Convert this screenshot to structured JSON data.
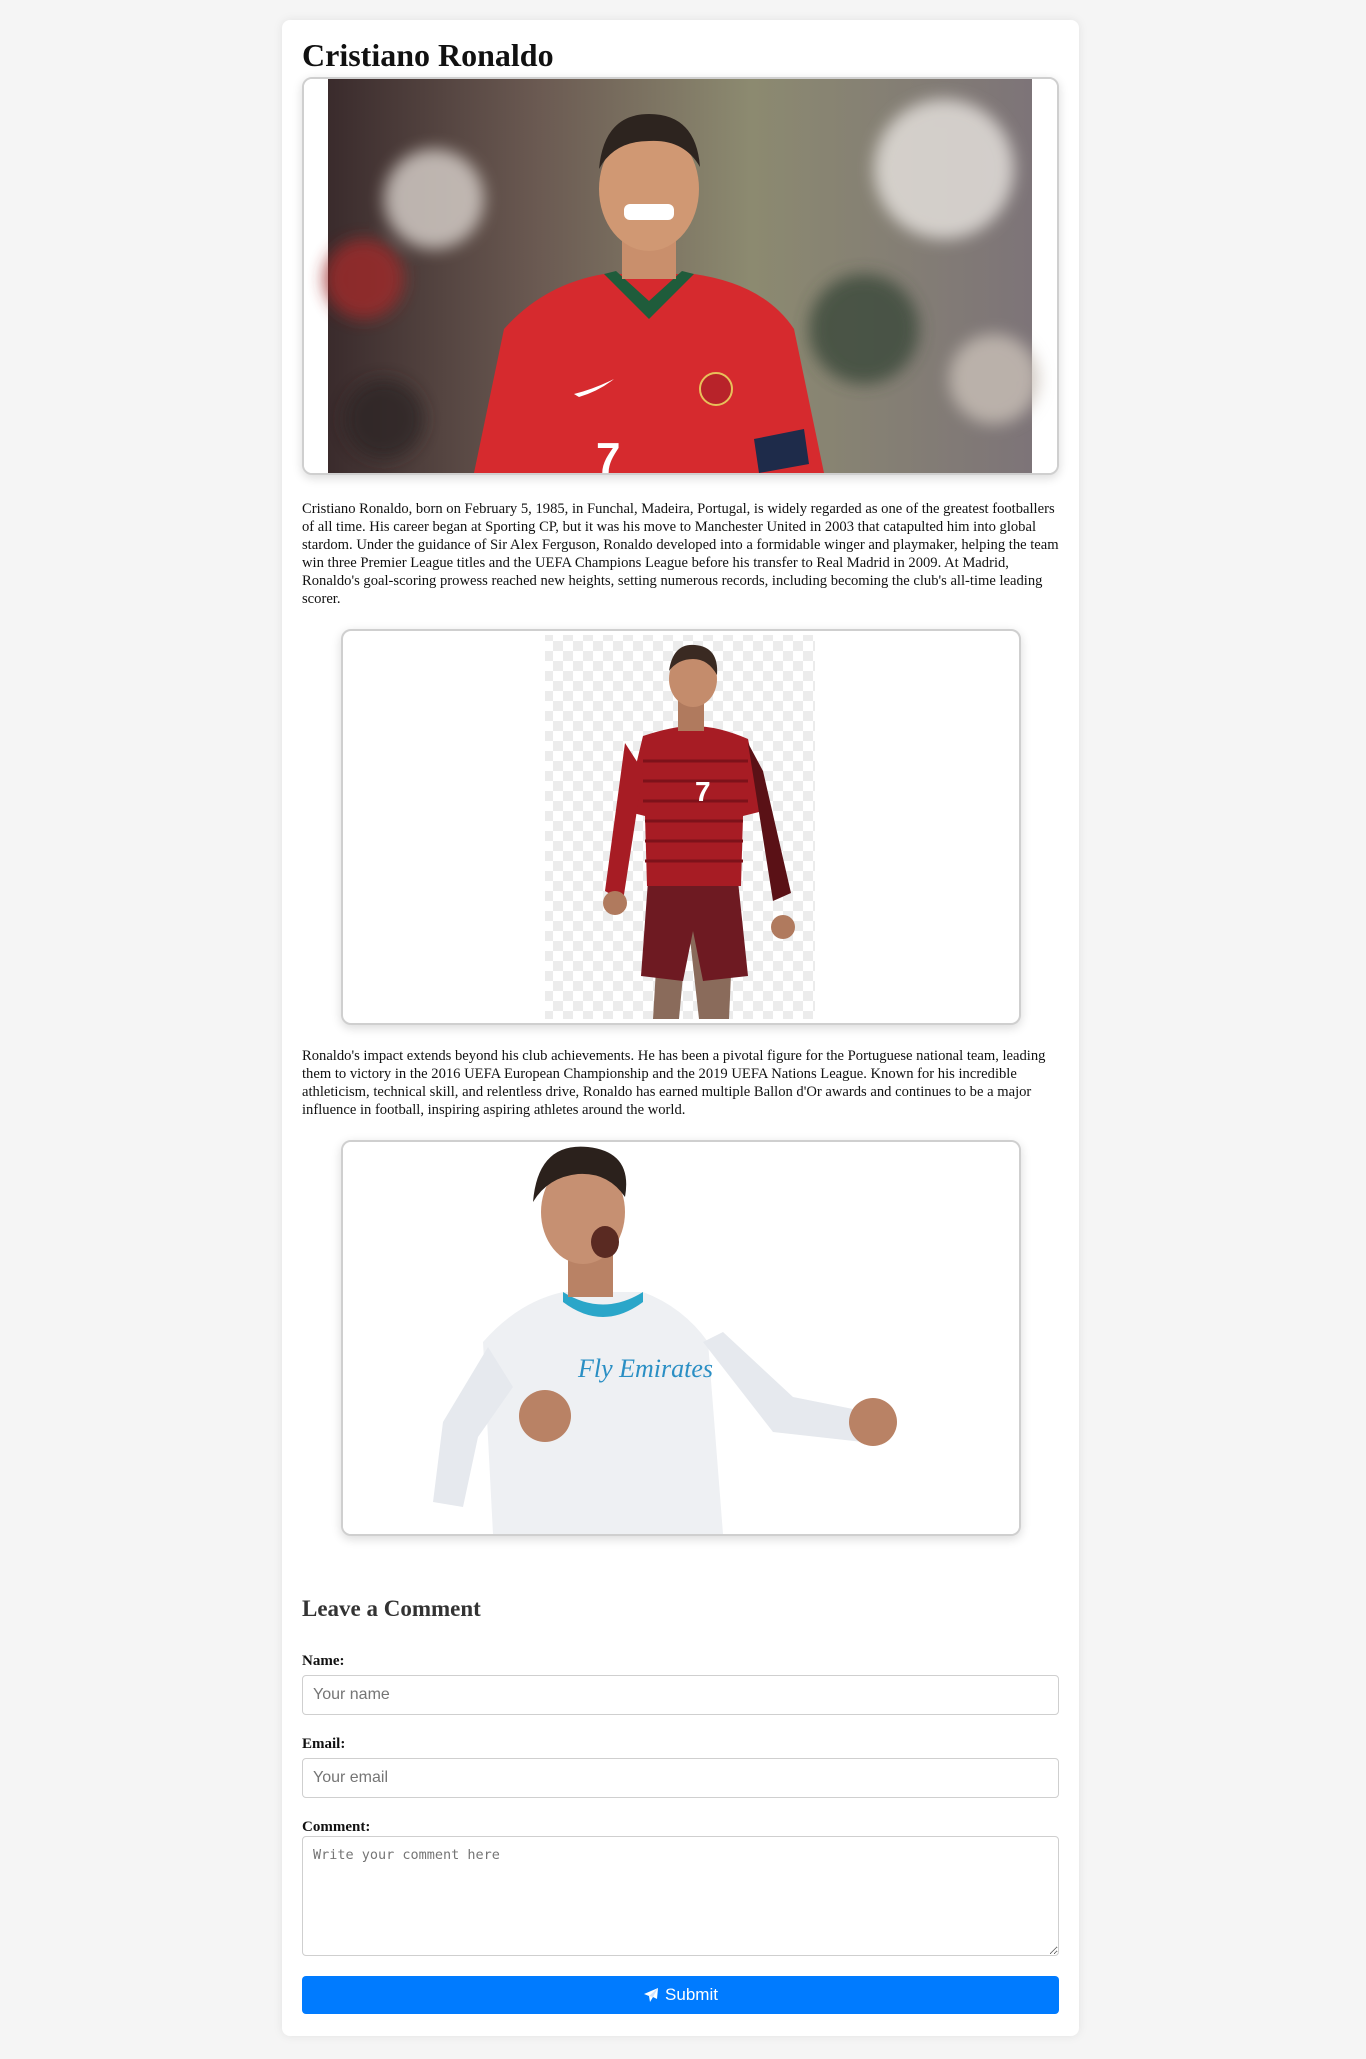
{
  "article": {
    "title": "Cristiano Ronaldo",
    "paragraph_1": "Cristiano Ronaldo, born on February 5, 1985, in Funchal, Madeira, Portugal, is widely regarded as one of the greatest footballers of all time. His career began at Sporting CP, but it was his move to Manchester United in 2003 that catapulted him into global stardom. Under the guidance of Sir Alex Ferguson, Ronaldo developed into a formidable winger and playmaker, helping the team win three Premier League titles and the UEFA Champions League before his transfer to Real Madrid in 2009. At Madrid, Ronaldo's goal-scoring prowess reached new heights, setting numerous records, including becoming the club's all-time leading scorer.",
    "paragraph_2": "Ronaldo's impact extends beyond his club achievements. He has been a pivotal figure for the Portuguese national team, leading them to victory in the 2016 UEFA European Championship and the 2019 UEFA Nations League. Known for his incredible athleticism, technical skill, and relentless drive, Ronaldo has earned multiple Ballon d'Or awards and continues to be a major influence in football, inspiring aspiring athletes around the world.",
    "image_1": {
      "jersey_number": "7",
      "jersey_color": "#d62a2e"
    },
    "image_2": {
      "jersey_number": "7",
      "jersey_color": "#a71c24"
    },
    "image_3": {
      "sponsor": "Fly Emirates",
      "jersey_color": "#f0f2f5"
    }
  },
  "comment_form": {
    "heading": "Leave a Comment",
    "name_label": "Name:",
    "name_placeholder": "Your name",
    "email_label": "Email:",
    "email_placeholder": "Your email",
    "comment_label": "Comment:",
    "comment_placeholder": "Write your comment here",
    "submit_label": "Submit",
    "submit_icon": "paper-plane-icon"
  },
  "colors": {
    "accent": "#007bff",
    "background": "#f5f5f5"
  }
}
